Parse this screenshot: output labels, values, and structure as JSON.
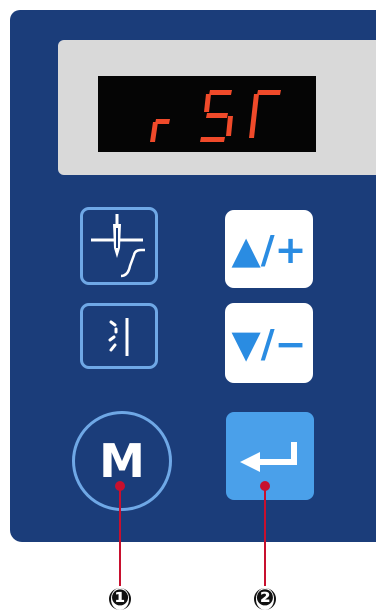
{
  "display": {
    "text": "rSr"
  },
  "buttons": {
    "plus_label": "▲/+",
    "minus_label": "▼/−",
    "mode_label": "M"
  },
  "callouts": [
    {
      "label": "❶"
    },
    {
      "label": "❷"
    }
  ],
  "colors": {
    "panel": "#1b3d7a",
    "button_outline": "#6fa8e6",
    "enter_button": "#4aa0ea",
    "led_segments": "#f04a2a",
    "callout_line": "#c8102e"
  }
}
